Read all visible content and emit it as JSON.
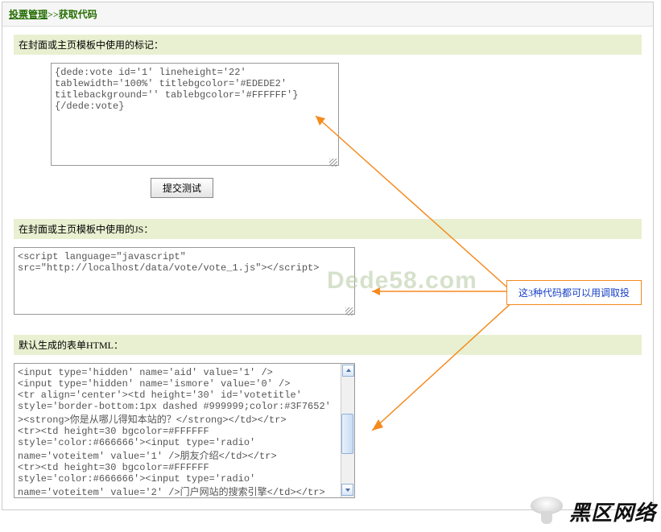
{
  "crumb": {
    "parent": "投票管理",
    "sep": ">>",
    "current": "获取代码"
  },
  "section1": {
    "title": "在封面或主页模板中使用的标记：",
    "code": "{dede:vote id='1' lineheight='22'\ntablewidth='100%' titlebgcolor='#EDEDE2'\ntitlebackground='' tablebgcolor='#FFFFFF'}\n{/dede:vote}",
    "button": "提交测试"
  },
  "section2": {
    "title": "在封面或主页模板中使用的JS：",
    "code": "<script language=\"javascript\" src=\"http://localhost/data/vote/vote_1.js\"></script>"
  },
  "section3": {
    "title": "默认生成的表单HTML：",
    "code": "<input type='hidden' name='aid' value='1' />\n<input type='hidden' name='ismore' value='0' />\n<tr align='center'><td height='30' id='votetitle' style='border-bottom:1px dashed #999999;color:#3F7652' ><strong>你是从哪儿得知本站的？</strong></td></tr>\n<tr><td height=30 bgcolor=#FFFFFF style='color:#666666'><input type='radio' name='voteitem' value='1' />朋友介绍</td></tr>\n<tr><td height=30 bgcolor=#FFFFFF style='color:#666666'><input type='radio' name='voteitem' value='2' />门户网站的搜索引擎</td></tr>"
  },
  "callout": "这3种代码都可以用调取投",
  "watermark": "Dede58.com",
  "brand": "黑区网络"
}
